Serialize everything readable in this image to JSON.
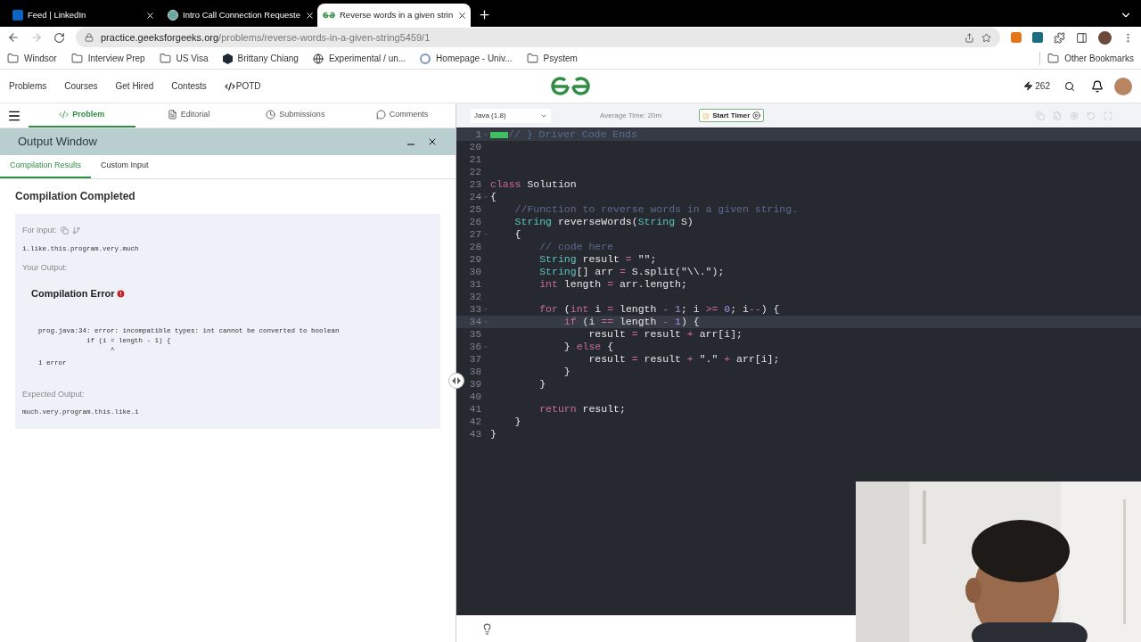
{
  "browser": {
    "tabs": [
      {
        "title": "Feed | LinkedIn",
        "kind": "linkedin",
        "selected": false
      },
      {
        "title": "Intro Call Connection Requeste",
        "kind": "round",
        "selected": false
      },
      {
        "title": "Reverse words in a given strin",
        "kind": "gg",
        "selected": true
      }
    ],
    "address_host": "practice.geeksforgeeks.org",
    "address_path": "/problems/reverse-words-in-a-given-string5459/1",
    "bookmarks": [
      {
        "label": "Windsor",
        "kind": "folder"
      },
      {
        "label": "Interview Prep",
        "kind": "folder"
      },
      {
        "label": "US Visa",
        "kind": "folder"
      },
      {
        "label": "Brittany Chiang",
        "kind": "hexagon"
      },
      {
        "label": "Experimental / un...",
        "kind": "globe"
      },
      {
        "label": "Homepage - Univ...",
        "kind": "wordpress"
      },
      {
        "label": "Psystem",
        "kind": "folder"
      }
    ],
    "other_bookmarks": "Other Bookmarks"
  },
  "site_nav": {
    "links": [
      {
        "label": "Problems",
        "kind": "plain"
      },
      {
        "label": "Courses",
        "kind": "plain"
      },
      {
        "label": "Get Hired",
        "kind": "plain"
      },
      {
        "label": "Contests",
        "kind": "plain"
      },
      {
        "label": "POTD",
        "kind": "code"
      }
    ],
    "streak": "262"
  },
  "problem_tabs": [
    {
      "label": "Problem",
      "kind": "code",
      "selected": true
    },
    {
      "label": "Editorial",
      "kind": "file",
      "selected": false
    },
    {
      "label": "Submissions",
      "kind": "clock",
      "selected": false
    },
    {
      "label": "Comments",
      "kind": "comment",
      "selected": false
    }
  ],
  "output_window": {
    "title": "Output Window",
    "tabs": [
      {
        "label": "Compilation Results",
        "selected": true
      },
      {
        "label": "Custom Input",
        "selected": false
      }
    ],
    "status": "Compilation Completed",
    "input_label": "For Input:",
    "input": "i.like.this.program.very.much",
    "output_label": "Your Output:",
    "error_title": "Compilation Error",
    "error_lines": [
      "prog.java:34: error: incompatible types: int cannot be converted to boolean",
      "            if (i = length - 1) {",
      "                  ^",
      "1 error"
    ],
    "expected_label": "Expected Output:",
    "expected": "much.very.program.this.like.i"
  },
  "editor": {
    "language": "Java (1.8)",
    "average_time": "Average Time: 20m",
    "timer_button": "Start Timer",
    "lines": [
      {
        "number": "1",
        "foldable": true,
        "folded": true,
        "highlighted": true,
        "tokens": [
          {
            "kind": "comment",
            "text": "// } Driver Code Ends"
          }
        ]
      },
      {
        "number": "20",
        "foldable": false,
        "folded": false,
        "highlighted": false
      },
      {
        "number": "21",
        "foldable": false,
        "folded": false,
        "highlighted": false
      },
      {
        "number": "22",
        "foldable": false,
        "folded": false,
        "highlighted": false
      },
      {
        "number": "23",
        "foldable": false,
        "folded": false,
        "highlighted": false,
        "tokens": [
          {
            "kind": "keyword",
            "text": "class"
          },
          {
            "kind": "plain",
            "text": " Solution"
          }
        ]
      },
      {
        "number": "24",
        "foldable": true,
        "folded": false,
        "highlighted": false,
        "tokens": [
          {
            "kind": "plain",
            "text": "{"
          }
        ]
      },
      {
        "number": "25",
        "foldable": false,
        "folded": false,
        "highlighted": false,
        "tokens": [
          {
            "kind": "comment",
            "text": "    //Function to reverse words in a given string."
          }
        ]
      },
      {
        "number": "26",
        "foldable": false,
        "folded": false,
        "highlighted": false,
        "tokens": [
          {
            "kind": "type",
            "text": "    String"
          },
          {
            "kind": "plain",
            "text": " reverseWords("
          },
          {
            "kind": "type",
            "text": "String"
          },
          {
            "kind": "plain",
            "text": " S)"
          }
        ]
      },
      {
        "number": "27",
        "foldable": true,
        "folded": false,
        "highlighted": false,
        "tokens": [
          {
            "kind": "plain",
            "text": "    {"
          }
        ]
      },
      {
        "number": "28",
        "foldable": false,
        "folded": false,
        "highlighted": false,
        "tokens": [
          {
            "kind": "comment",
            "text": "        // code here"
          }
        ]
      },
      {
        "number": "29",
        "foldable": false,
        "folded": false,
        "highlighted": false,
        "tokens": [
          {
            "kind": "type",
            "text": "        String"
          },
          {
            "kind": "plain",
            "text": " result "
          },
          {
            "kind": "operator",
            "text": "="
          },
          {
            "kind": "string",
            "text": " \"\""
          },
          {
            "kind": "plain",
            "text": ";"
          }
        ]
      },
      {
        "number": "30",
        "foldable": false,
        "folded": false,
        "highlighted": false,
        "tokens": [
          {
            "kind": "type",
            "text": "        String"
          },
          {
            "kind": "plain",
            "text": "[] arr "
          },
          {
            "kind": "operator",
            "text": "="
          },
          {
            "kind": "plain",
            "text": " S.split("
          },
          {
            "kind": "string",
            "text": "\"\\\\.\""
          },
          {
            "kind": "plain",
            "text": ");"
          }
        ]
      },
      {
        "number": "31",
        "foldable": false,
        "folded": false,
        "highlighted": false,
        "tokens": [
          {
            "kind": "keyword",
            "text": "        int"
          },
          {
            "kind": "plain",
            "text": " length "
          },
          {
            "kind": "operator",
            "text": "="
          },
          {
            "kind": "plain",
            "text": " arr.length;"
          }
        ]
      },
      {
        "number": "32",
        "foldable": false,
        "folded": false,
        "highlighted": false
      },
      {
        "number": "33",
        "foldable": true,
        "folded": false,
        "highlighted": false,
        "tokens": [
          {
            "kind": "keyword",
            "text": "        for"
          },
          {
            "kind": "plain",
            "text": " ("
          },
          {
            "kind": "keyword",
            "text": "int"
          },
          {
            "kind": "plain",
            "text": " i "
          },
          {
            "kind": "operator",
            "text": "="
          },
          {
            "kind": "plain",
            "text": " length "
          },
          {
            "kind": "operator",
            "text": "-"
          },
          {
            "kind": "number",
            "text": " 1"
          },
          {
            "kind": "plain",
            "text": "; i "
          },
          {
            "kind": "operator",
            "text": ">="
          },
          {
            "kind": "number",
            "text": " 0"
          },
          {
            "kind": "plain",
            "text": "; i"
          },
          {
            "kind": "operator",
            "text": "--"
          },
          {
            "kind": "plain",
            "text": ") {"
          }
        ]
      },
      {
        "number": "34",
        "foldable": true,
        "folded": false,
        "highlighted": true,
        "tokens": [
          {
            "kind": "keyword",
            "text": "            if"
          },
          {
            "kind": "plain",
            "text": " (i "
          },
          {
            "kind": "operator",
            "text": "=="
          },
          {
            "kind": "plain",
            "text": " length "
          },
          {
            "kind": "operator",
            "text": "-"
          },
          {
            "kind": "number",
            "text": " 1"
          },
          {
            "kind": "plain",
            "text": ") {"
          }
        ]
      },
      {
        "number": "35",
        "foldable": false,
        "folded": false,
        "highlighted": false,
        "tokens": [
          {
            "kind": "plain",
            "text": "                result "
          },
          {
            "kind": "operator",
            "text": "="
          },
          {
            "kind": "plain",
            "text": " result "
          },
          {
            "kind": "operator",
            "text": "+"
          },
          {
            "kind": "plain",
            "text": " arr[i];"
          }
        ]
      },
      {
        "number": "36",
        "foldable": true,
        "folded": false,
        "highlighted": false,
        "tokens": [
          {
            "kind": "plain",
            "text": "            } "
          },
          {
            "kind": "keyword",
            "text": "else"
          },
          {
            "kind": "plain",
            "text": " {"
          }
        ]
      },
      {
        "number": "37",
        "foldable": false,
        "folded": false,
        "highlighted": false,
        "tokens": [
          {
            "kind": "plain",
            "text": "                result "
          },
          {
            "kind": "operator",
            "text": "="
          },
          {
            "kind": "plain",
            "text": " result "
          },
          {
            "kind": "operator",
            "text": "+"
          },
          {
            "kind": "string",
            "text": " \".\""
          },
          {
            "kind": "operator",
            "text": " +"
          },
          {
            "kind": "plain",
            "text": " arr[i];"
          }
        ]
      },
      {
        "number": "38",
        "foldable": false,
        "folded": false,
        "highlighted": false,
        "tokens": [
          {
            "kind": "plain",
            "text": "            }"
          }
        ]
      },
      {
        "number": "39",
        "foldable": false,
        "folded": false,
        "highlighted": false,
        "tokens": [
          {
            "kind": "plain",
            "text": "        }"
          }
        ]
      },
      {
        "number": "40",
        "foldable": false,
        "folded": false,
        "highlighted": false
      },
      {
        "number": "41",
        "foldable": false,
        "folded": false,
        "highlighted": false,
        "tokens": [
          {
            "kind": "keyword",
            "text": "        return"
          },
          {
            "kind": "plain",
            "text": " result;"
          }
        ]
      },
      {
        "number": "42",
        "foldable": false,
        "folded": false,
        "highlighted": false,
        "tokens": [
          {
            "kind": "plain",
            "text": "    }"
          }
        ]
      },
      {
        "number": "43",
        "foldable": false,
        "folded": false,
        "highlighted": false,
        "tokens": [
          {
            "kind": "plain",
            "text": "}"
          }
        ]
      }
    ]
  }
}
